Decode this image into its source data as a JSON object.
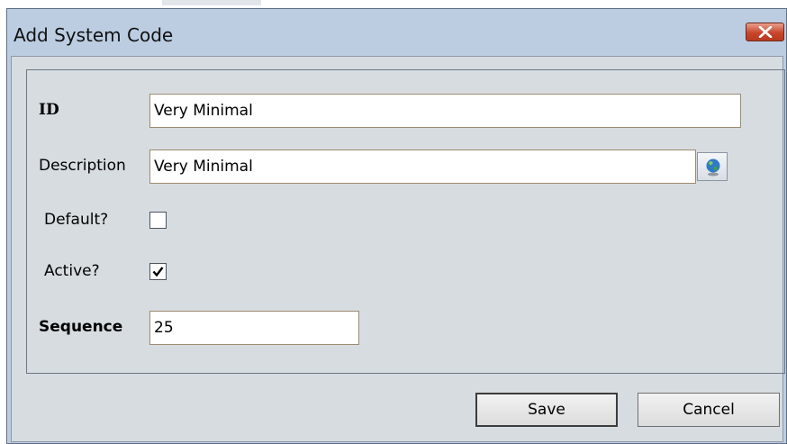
{
  "window": {
    "title": "Add System Code",
    "close_icon": "close-icon"
  },
  "form": {
    "id": {
      "label": "ID",
      "value": "Very Minimal"
    },
    "description": {
      "label": "Description",
      "value": "Very Minimal",
      "button_icon": "globe-icon"
    },
    "default": {
      "label": "Default?",
      "checked": false
    },
    "active": {
      "label": "Active?",
      "checked": true
    },
    "sequence": {
      "label": "Sequence",
      "value": "25"
    }
  },
  "buttons": {
    "save": "Save",
    "cancel": "Cancel"
  },
  "colors": {
    "titlebar": "#bccde2",
    "client": "#d7dce1",
    "close": "#c9462c"
  }
}
